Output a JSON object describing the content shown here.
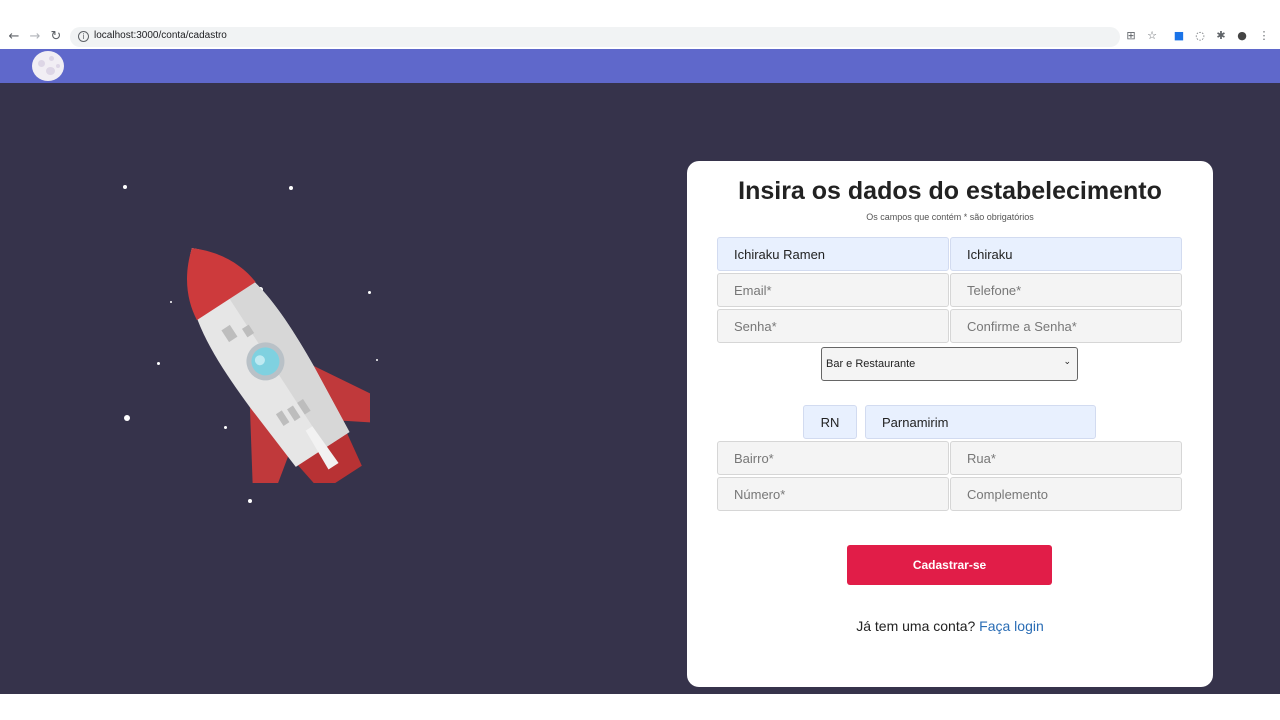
{
  "browser": {
    "url": "localhost:3000/conta/cadastro"
  },
  "form": {
    "title": "Insira os dados do estabelecimento",
    "subtitle": "Os campos que contém * são obrigatórios",
    "fields": {
      "nome": {
        "value": "Ichiraku Ramen"
      },
      "nome_fantasia": {
        "value": "Ichiraku"
      },
      "email": {
        "placeholder": "Email*"
      },
      "telefone": {
        "placeholder": "Telefone*"
      },
      "senha": {
        "placeholder": "Senha*"
      },
      "confirme_senha": {
        "placeholder": "Confirme a Senha*"
      },
      "estado": {
        "value": "RN"
      },
      "cidade": {
        "value": "Parnamirim"
      },
      "bairro": {
        "placeholder": "Bairro*"
      },
      "rua": {
        "placeholder": "Rua*"
      },
      "numero": {
        "placeholder": "Número*"
      },
      "complemento": {
        "placeholder": "Complemento"
      }
    },
    "categoria": {
      "selected": "Bar e Restaurante"
    },
    "submit_label": "Cadastrar-se",
    "login_prompt": "Já tem uma conta?",
    "login_link": "Faça login"
  },
  "colors": {
    "header": "#5f68cb",
    "background": "#36334b",
    "button": "#e11d48",
    "link": "#2a6db5"
  },
  "icons": [
    "back-arrow-icon",
    "forward-arrow-icon",
    "reload-icon",
    "info-icon",
    "translate-icon",
    "star-icon",
    "extension-icon",
    "shield-icon",
    "puzzle-icon",
    "profile-icon",
    "menu-dots-icon",
    "moon-logo-icon",
    "rocket-illustration"
  ]
}
